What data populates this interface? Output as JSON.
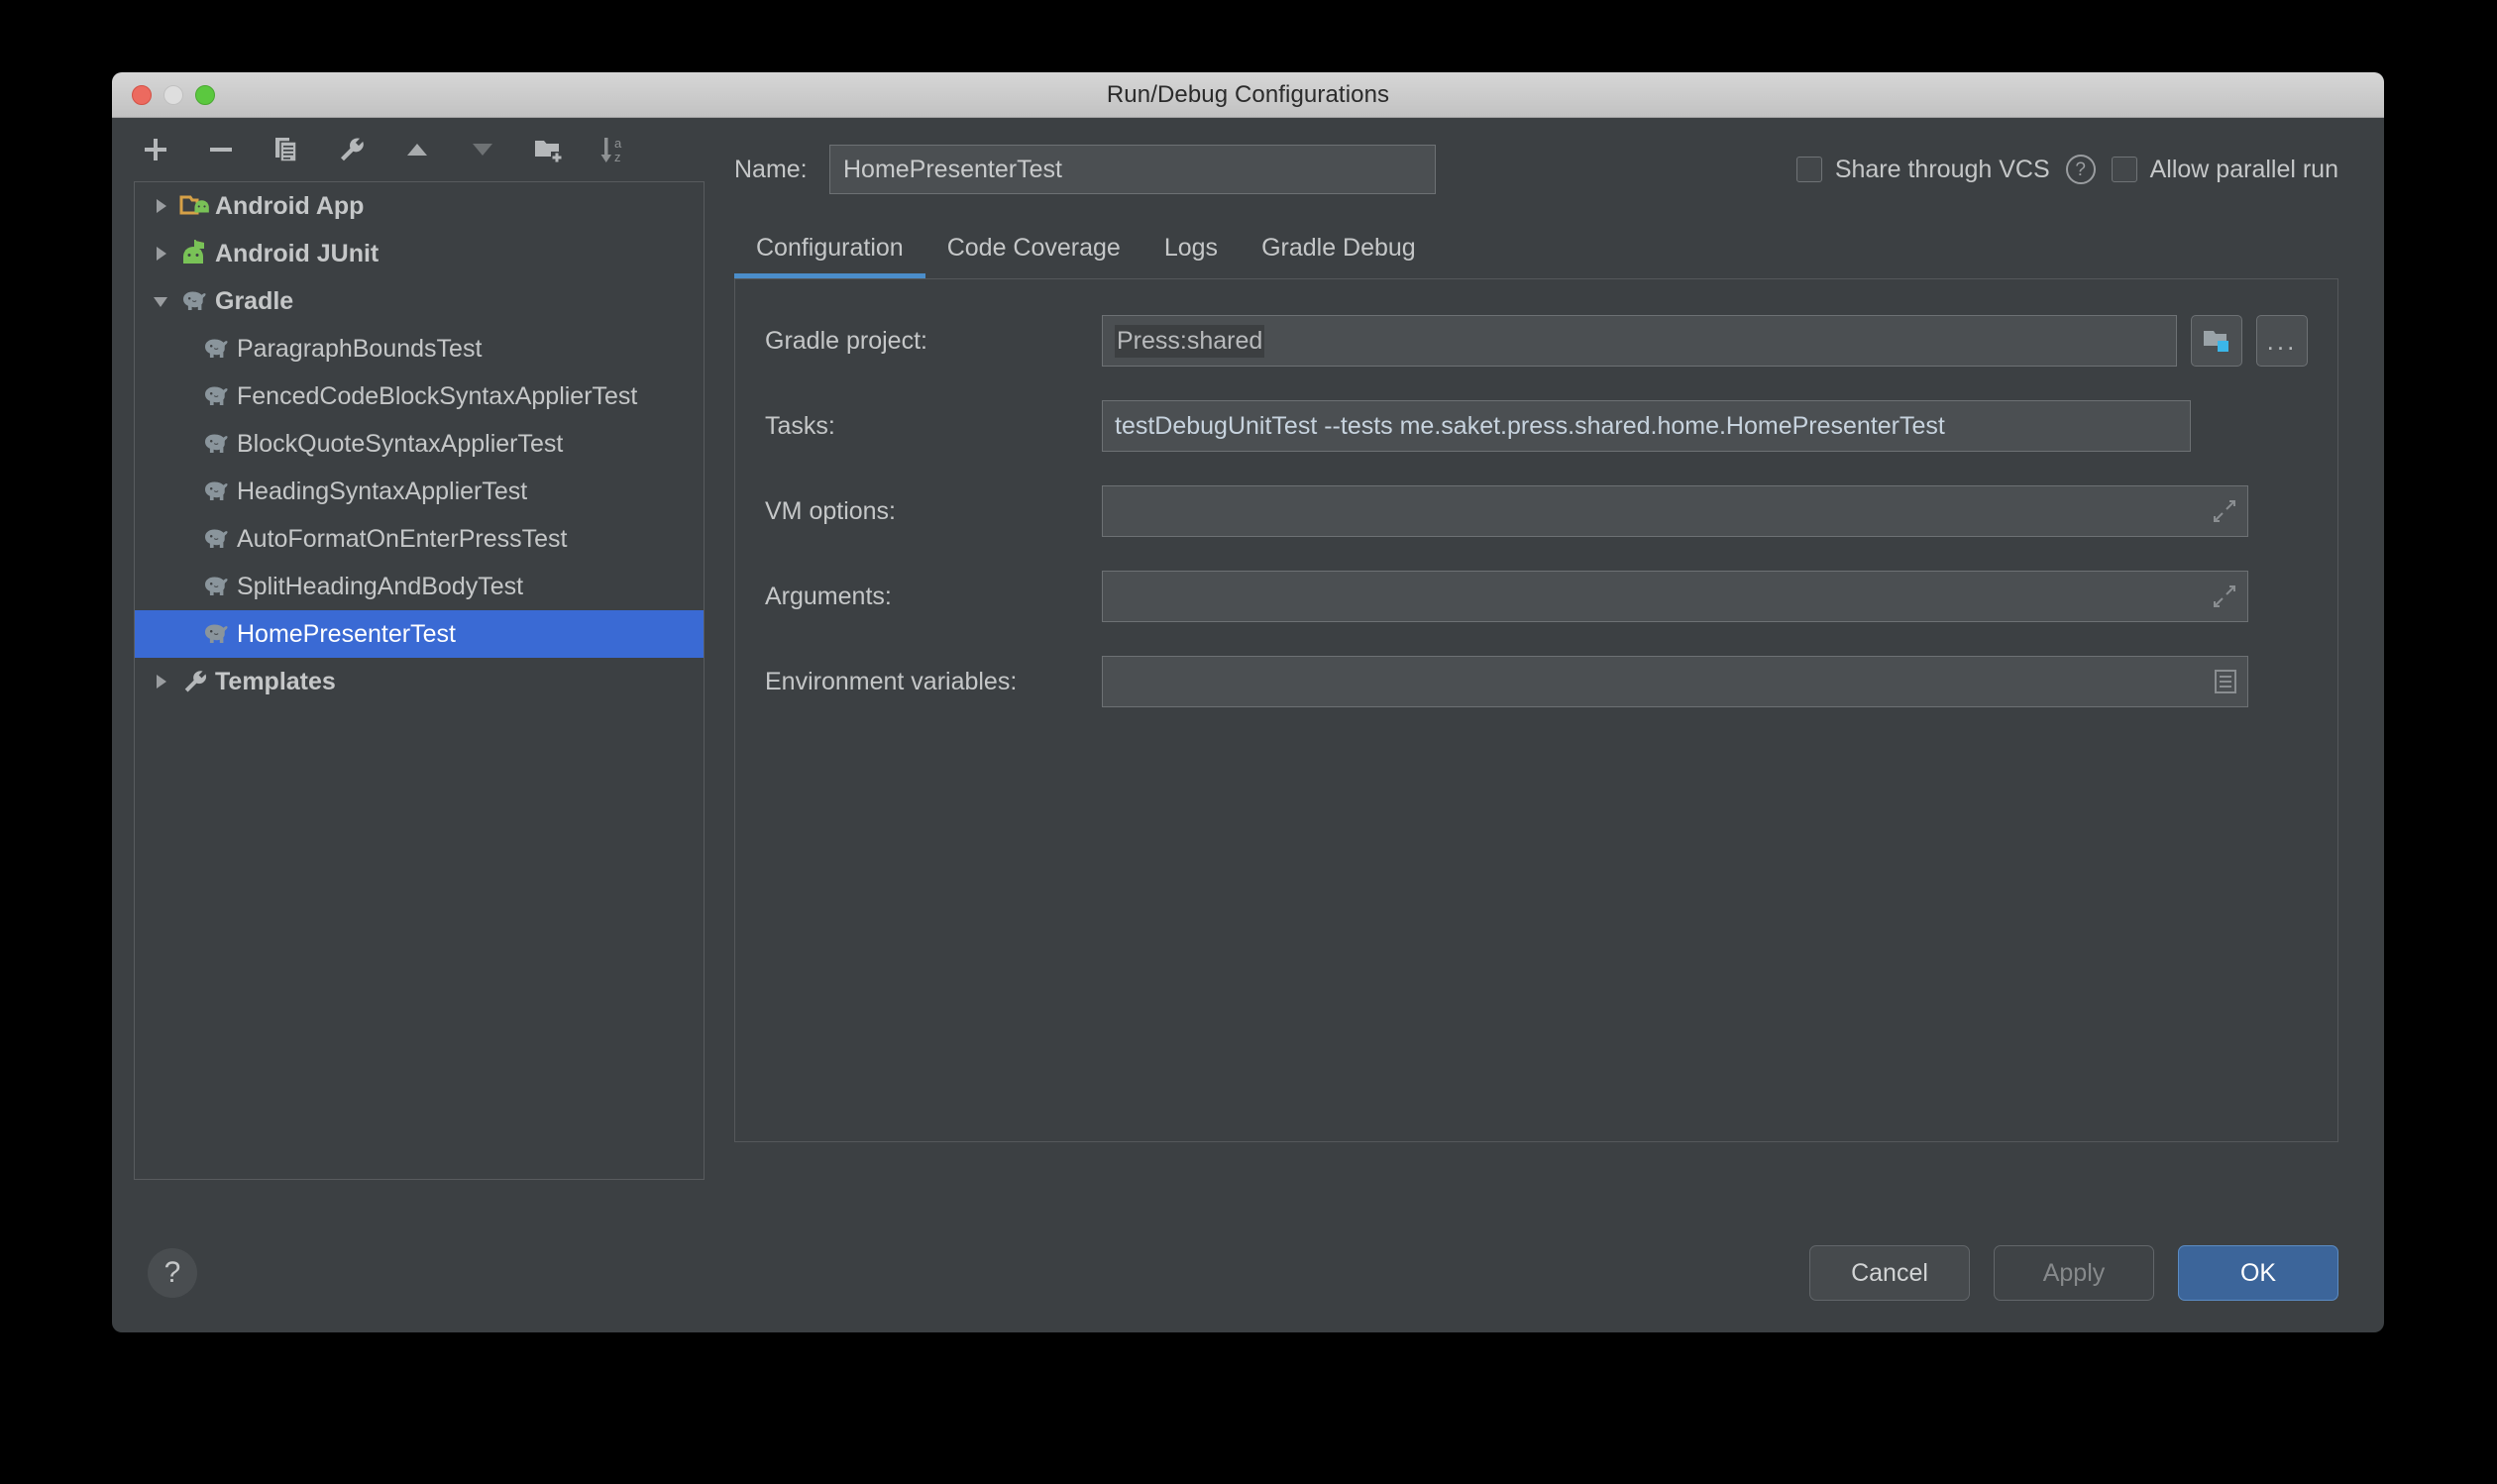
{
  "window": {
    "title": "Run/Debug Configurations",
    "traffic_lights": [
      "close",
      "minimize",
      "maximize"
    ]
  },
  "toolbar": {
    "buttons": [
      {
        "name": "add-button",
        "icon": "plus-icon"
      },
      {
        "name": "remove-button",
        "icon": "minus-icon"
      },
      {
        "name": "copy-configuration-button",
        "icon": "copy-icon"
      },
      {
        "name": "edit-templates-button",
        "icon": "wrench-icon"
      },
      {
        "name": "move-up-button",
        "icon": "triangle-up-icon"
      },
      {
        "name": "move-down-button",
        "icon": "triangle-down-icon"
      },
      {
        "name": "new-folder-button",
        "icon": "folder-plus-icon"
      },
      {
        "name": "sort-alphabetically-button",
        "icon": "sort-az-icon"
      }
    ]
  },
  "tree": {
    "items": [
      {
        "label": "Android App",
        "icon": "android-app-folder-icon",
        "level": 0,
        "expander": "collapsed",
        "bold": true,
        "selected": false
      },
      {
        "label": "Android JUnit",
        "icon": "android-junit-icon",
        "level": 0,
        "expander": "collapsed",
        "bold": true,
        "selected": false
      },
      {
        "label": "Gradle",
        "icon": "gradle-elephant-icon",
        "level": 0,
        "expander": "expanded",
        "bold": true,
        "selected": false
      },
      {
        "label": "ParagraphBoundsTest",
        "icon": "gradle-elephant-icon",
        "level": 1,
        "expander": "none",
        "bold": false,
        "selected": false
      },
      {
        "label": "FencedCodeBlockSyntaxApplierTest",
        "icon": "gradle-elephant-icon",
        "level": 1,
        "expander": "none",
        "bold": false,
        "selected": false
      },
      {
        "label": "BlockQuoteSyntaxApplierTest",
        "icon": "gradle-elephant-icon",
        "level": 1,
        "expander": "none",
        "bold": false,
        "selected": false
      },
      {
        "label": "HeadingSyntaxApplierTest",
        "icon": "gradle-elephant-icon",
        "level": 1,
        "expander": "none",
        "bold": false,
        "selected": false
      },
      {
        "label": "AutoFormatOnEnterPressTest",
        "icon": "gradle-elephant-icon",
        "level": 1,
        "expander": "none",
        "bold": false,
        "selected": false
      },
      {
        "label": "SplitHeadingAndBodyTest",
        "icon": "gradle-elephant-icon",
        "level": 1,
        "expander": "none",
        "bold": false,
        "selected": false
      },
      {
        "label": "HomePresenterTest",
        "icon": "gradle-elephant-icon",
        "level": 1,
        "expander": "none",
        "bold": false,
        "selected": true
      },
      {
        "label": "Templates",
        "icon": "wrench-icon",
        "level": 0,
        "expander": "collapsed",
        "bold": true,
        "selected": false
      }
    ]
  },
  "header": {
    "name_label": "Name:",
    "name_value": "HomePresenterTest",
    "share_vcs_label": "Share through VCS",
    "share_vcs_checked": false,
    "help_icon": "question-mark-icon",
    "allow_parallel_label": "Allow parallel run",
    "allow_parallel_checked": false
  },
  "tabs": [
    {
      "label": "Configuration",
      "active": true
    },
    {
      "label": "Code Coverage",
      "active": false
    },
    {
      "label": "Logs",
      "active": false
    },
    {
      "label": "Gradle Debug",
      "active": false
    }
  ],
  "form": {
    "gradle_project": {
      "label": "Gradle project:",
      "value": "Press:shared",
      "browse_icon": "folder-module-icon",
      "more_label": "..."
    },
    "tasks": {
      "label": "Tasks:",
      "value": "testDebugUnitTest --tests me.saket.press.shared.home.HomePresenterTest"
    },
    "vm_options": {
      "label": "VM options:",
      "value": "",
      "expand_icon": "expand-diagonal-icon"
    },
    "arguments": {
      "label": "Arguments:",
      "value": "",
      "expand_icon": "expand-diagonal-icon"
    },
    "environment_variables": {
      "label": "Environment variables:",
      "value": "",
      "list_icon": "list-document-icon"
    }
  },
  "footer": {
    "help_label": "?",
    "cancel_label": "Cancel",
    "apply_label": "Apply",
    "apply_enabled": false,
    "ok_label": "OK"
  },
  "colors": {
    "window_bg": "#3c4043",
    "selection_blue": "#3a6ad4",
    "tab_accent": "#4b8ecb",
    "primary_button": "#3c659a",
    "text": "#c5c7c8",
    "field_bg": "#4b4f52",
    "android_green": "#78c257",
    "folder_orange": "#d9a köz"
  }
}
